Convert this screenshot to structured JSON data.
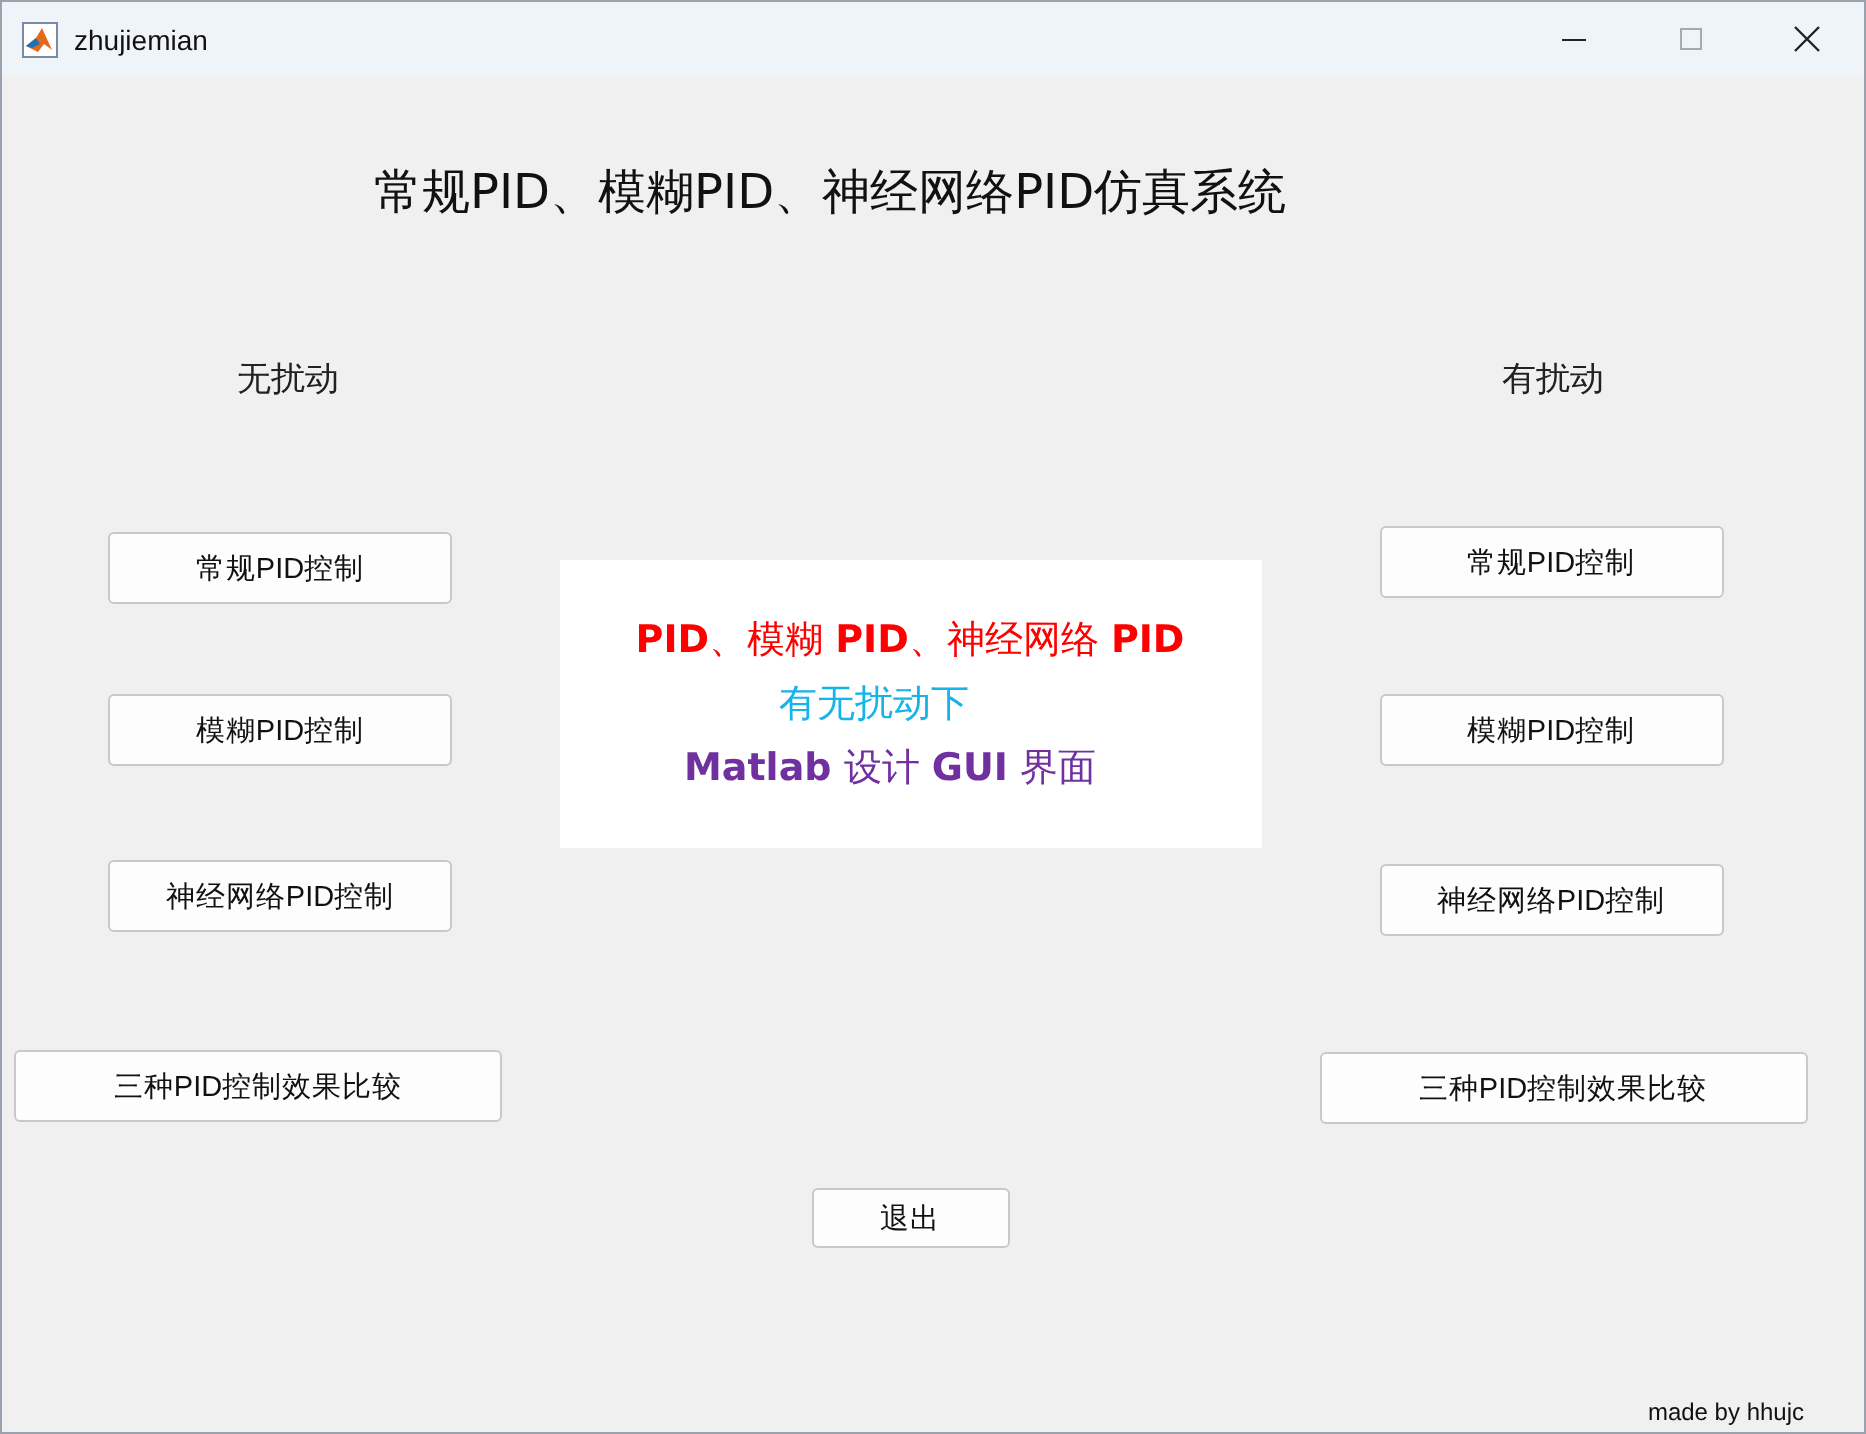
{
  "window": {
    "title": "zhujiemian"
  },
  "heading": "常规PID、模糊PID、神经网络PID仿真系统",
  "left": {
    "label": "无扰动",
    "buttons": [
      "常规PID控制",
      "模糊PID控制",
      "神经网络PID控制",
      "三种PID控制效果比较"
    ]
  },
  "right": {
    "label": "有扰动",
    "buttons": [
      "常规PID控制",
      "模糊PID控制",
      "神经网络PID控制",
      "三种PID控制效果比较"
    ]
  },
  "banner": {
    "lines": [
      {
        "text": "**PID**、模糊 **PID**、神经网络 **PID**",
        "color": "#ff0000"
      },
      {
        "text": "有无扰动下",
        "color": "#16b4e8"
      },
      {
        "text": "**Matlab** 设计 **GUI** 界面",
        "color": "#7030a0"
      }
    ]
  },
  "exit_button": "退出",
  "footer": "made by hhujc"
}
